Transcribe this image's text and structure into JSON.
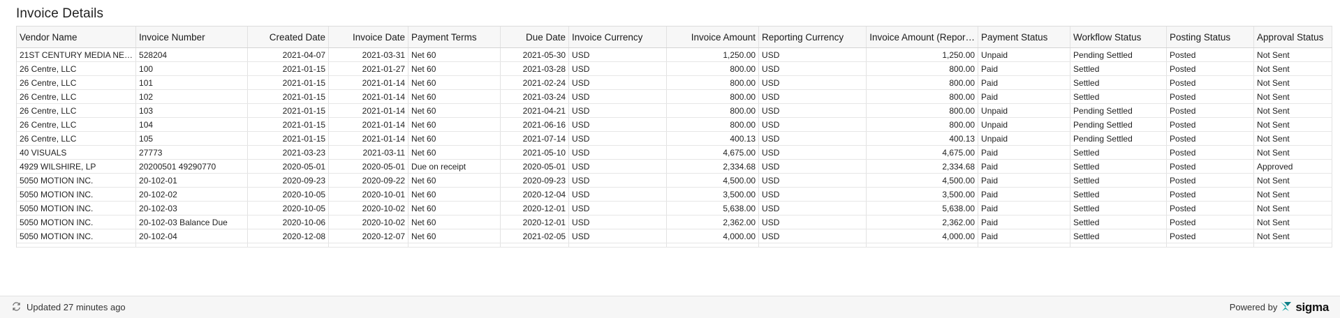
{
  "title": "Invoice Details",
  "columns": [
    {
      "label": "Vendor Name",
      "align": "left"
    },
    {
      "label": "Invoice Number",
      "align": "left"
    },
    {
      "label": "Created Date",
      "align": "right"
    },
    {
      "label": "Invoice Date",
      "align": "right"
    },
    {
      "label": "Payment Terms",
      "align": "left"
    },
    {
      "label": "Due Date",
      "align": "right"
    },
    {
      "label": "Invoice Currency",
      "align": "left"
    },
    {
      "label": "Invoice Amount",
      "align": "right"
    },
    {
      "label": "Reporting Currency",
      "align": "left"
    },
    {
      "label": "Invoice Amount (Repor…",
      "align": "right"
    },
    {
      "label": "Payment Status",
      "align": "left"
    },
    {
      "label": "Workflow Status",
      "align": "left"
    },
    {
      "label": "Posting Status",
      "align": "left"
    },
    {
      "label": "Approval Status",
      "align": "left"
    }
  ],
  "rows": [
    [
      "21ST CENTURY MEDIA NE…",
      "528204",
      "2021-04-07",
      "2021-03-31",
      "Net 60",
      "2021-05-30",
      "USD",
      "1,250.00",
      "USD",
      "1,250.00",
      "Unpaid",
      "Pending Settled",
      "Posted",
      "Not Sent"
    ],
    [
      "26 Centre, LLC",
      "100",
      "2021-01-15",
      "2021-01-27",
      "Net 60",
      "2021-03-28",
      "USD",
      "800.00",
      "USD",
      "800.00",
      "Paid",
      "Settled",
      "Posted",
      "Not Sent"
    ],
    [
      "26 Centre, LLC",
      "101",
      "2021-01-15",
      "2021-01-14",
      "Net 60",
      "2021-02-24",
      "USD",
      "800.00",
      "USD",
      "800.00",
      "Paid",
      "Settled",
      "Posted",
      "Not Sent"
    ],
    [
      "26 Centre, LLC",
      "102",
      "2021-01-15",
      "2021-01-14",
      "Net 60",
      "2021-03-24",
      "USD",
      "800.00",
      "USD",
      "800.00",
      "Paid",
      "Settled",
      "Posted",
      "Not Sent"
    ],
    [
      "26 Centre, LLC",
      "103",
      "2021-01-15",
      "2021-01-14",
      "Net 60",
      "2021-04-21",
      "USD",
      "800.00",
      "USD",
      "800.00",
      "Unpaid",
      "Pending Settled",
      "Posted",
      "Not Sent"
    ],
    [
      "26 Centre, LLC",
      "104",
      "2021-01-15",
      "2021-01-14",
      "Net 60",
      "2021-06-16",
      "USD",
      "800.00",
      "USD",
      "800.00",
      "Unpaid",
      "Pending Settled",
      "Posted",
      "Not Sent"
    ],
    [
      "26 Centre, LLC",
      "105",
      "2021-01-15",
      "2021-01-14",
      "Net 60",
      "2021-07-14",
      "USD",
      "400.13",
      "USD",
      "400.13",
      "Unpaid",
      "Pending Settled",
      "Posted",
      "Not Sent"
    ],
    [
      "40 VISUALS",
      "27773",
      "2021-03-23",
      "2021-03-11",
      "Net 60",
      "2021-05-10",
      "USD",
      "4,675.00",
      "USD",
      "4,675.00",
      "Paid",
      "Settled",
      "Posted",
      "Not Sent"
    ],
    [
      "4929 WILSHIRE, LP",
      "20200501 49290770",
      "2020-05-01",
      "2020-05-01",
      "Due on receipt",
      "2020-05-01",
      "USD",
      "2,334.68",
      "USD",
      "2,334.68",
      "Paid",
      "Settled",
      "Posted",
      "Approved"
    ],
    [
      "5050 MOTION INC.",
      "20-102-01",
      "2020-09-23",
      "2020-09-22",
      "Net 60",
      "2020-09-23",
      "USD",
      "4,500.00",
      "USD",
      "4,500.00",
      "Paid",
      "Settled",
      "Posted",
      "Not Sent"
    ],
    [
      "5050 MOTION INC.",
      "20-102-02",
      "2020-10-05",
      "2020-10-01",
      "Net 60",
      "2020-12-04",
      "USD",
      "3,500.00",
      "USD",
      "3,500.00",
      "Paid",
      "Settled",
      "Posted",
      "Not Sent"
    ],
    [
      "5050 MOTION INC.",
      "20-102-03",
      "2020-10-05",
      "2020-10-02",
      "Net 60",
      "2020-12-01",
      "USD",
      "5,638.00",
      "USD",
      "5,638.00",
      "Paid",
      "Settled",
      "Posted",
      "Not Sent"
    ],
    [
      "5050 MOTION INC.",
      "20-102-03 Balance Due",
      "2020-10-06",
      "2020-10-02",
      "Net 60",
      "2020-12-01",
      "USD",
      "2,362.00",
      "USD",
      "2,362.00",
      "Paid",
      "Settled",
      "Posted",
      "Not Sent"
    ],
    [
      "5050 MOTION INC.",
      "20-102-04",
      "2020-12-08",
      "2020-12-07",
      "Net 60",
      "2021-02-05",
      "USD",
      "4,000.00",
      "USD",
      "4,000.00",
      "Paid",
      "Settled",
      "Posted",
      "Not Sent"
    ]
  ],
  "footer": {
    "updated_text": "Updated 27 minutes ago",
    "refresh_icon": "refresh-icon",
    "powered_by": "Powered by",
    "brand": "sigma",
    "brand_color": "#1aa6a6"
  }
}
